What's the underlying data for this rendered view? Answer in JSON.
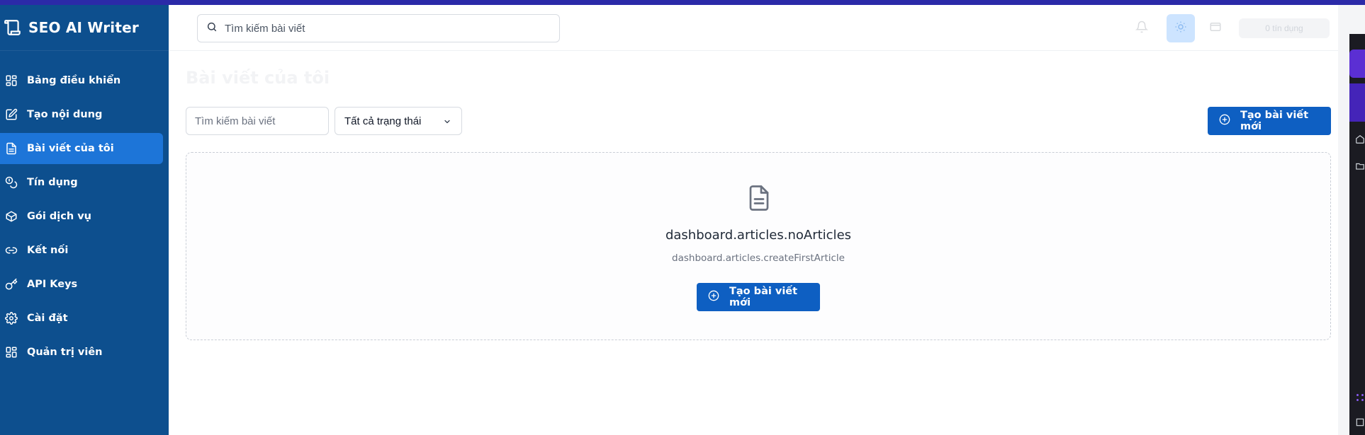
{
  "brand": {
    "title": "SEO AI Writer"
  },
  "sidebar": {
    "items": [
      {
        "label": "Bảng điều khiển",
        "icon": "dashboard-grid-icon",
        "active": false
      },
      {
        "label": "Tạo nội dung",
        "icon": "edit-square-icon",
        "active": false
      },
      {
        "label": "Bài viết của tôi",
        "icon": "document-icon",
        "active": true
      },
      {
        "label": "Tín dụng",
        "icon": "coins-icon",
        "active": false
      },
      {
        "label": "Gói dịch vụ",
        "icon": "package-icon",
        "active": false
      },
      {
        "label": "Kết nối",
        "icon": "link-icon",
        "active": false
      },
      {
        "label": "API Keys",
        "icon": "key-icon",
        "active": false
      },
      {
        "label": "Cài đặt",
        "icon": "gear-icon",
        "active": false
      },
      {
        "label": "Quản trị viên",
        "icon": "admin-grid-icon",
        "active": false
      }
    ]
  },
  "header": {
    "search_placeholder": "Tìm kiếm bài viết",
    "credits_label": "0 tín dụng"
  },
  "main": {
    "title": "Bài viết của tôi",
    "filter_placeholder": "Tìm kiếm bài viết",
    "status_selected": "Tất cả trạng thái",
    "new_article_label": "Tạo bài viết mới",
    "empty": {
      "title": "dashboard.articles.noArticles",
      "subtitle": "dashboard.articles.createFirstArticle",
      "button_label": "Tạo bài viết mới"
    }
  },
  "colors": {
    "sidebar_bg": "#0d4f8e",
    "sidebar_active": "#1d75d8",
    "primary_button": "#0e5fc2",
    "top_accent": "#2b2aa8"
  }
}
